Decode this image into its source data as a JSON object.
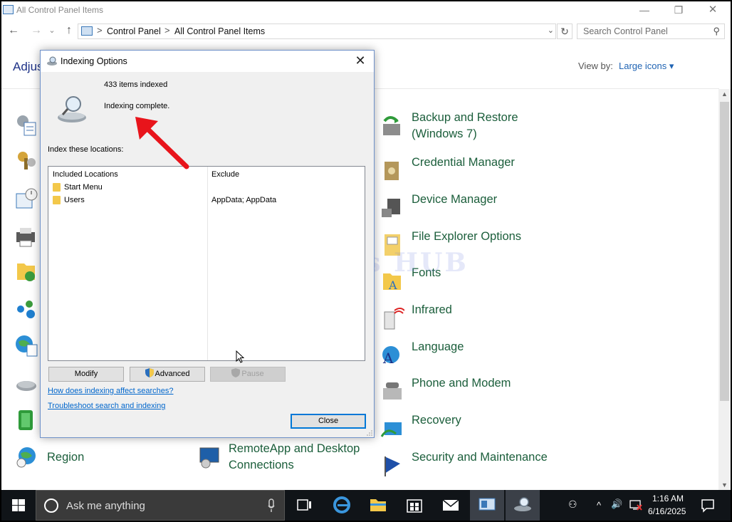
{
  "window": {
    "title": "All Control Panel Items",
    "minimize": "—",
    "restore": "❐",
    "close": "✕"
  },
  "nav": {
    "back": "←",
    "forward": "→",
    "dropdown": "⌄",
    "up": "↑"
  },
  "address": {
    "crumbs": [
      "Control Panel",
      "All Control Panel Items"
    ],
    "separator": ">",
    "dropdown": "⌄",
    "refresh": "↻"
  },
  "search": {
    "placeholder": "Search Control Panel",
    "icon": "⚲"
  },
  "header": {
    "title_partial": "Adjus",
    "view_by_label": "View by:",
    "view_by_value": "Large icons ▾"
  },
  "right_column_items": [
    {
      "label_line1": "Backup and Restore",
      "label_line2": "(Windows 7)",
      "icon": "backup-restore-icon"
    },
    {
      "label": "Credential Manager",
      "icon": "credential-manager-icon"
    },
    {
      "label": "Device Manager",
      "icon": "device-manager-icon"
    },
    {
      "label": "File Explorer Options",
      "icon": "file-explorer-options-icon"
    },
    {
      "label": "Fonts",
      "icon": "fonts-icon"
    },
    {
      "label": "Infrared",
      "icon": "infrared-icon"
    },
    {
      "label": "Language",
      "icon": "language-icon"
    },
    {
      "label": "Phone and Modem",
      "icon": "phone-modem-icon"
    },
    {
      "label": "Recovery",
      "icon": "recovery-icon"
    },
    {
      "label": "Security and Maintenance",
      "icon": "security-maintenance-icon"
    }
  ],
  "bottom_row": {
    "region": "Region",
    "remoteapp_line1": "RemoteApp and Desktop",
    "remoteapp_line2": "Connections"
  },
  "watermark": "IT Pros HUB",
  "dialog": {
    "title": "Indexing Options",
    "close_glyph": "✕",
    "items_indexed": "433 items indexed",
    "status": "Indexing complete.",
    "index_these": "Index these locations:",
    "columns": {
      "included": "Included Locations",
      "exclude": "Exclude"
    },
    "locations": [
      {
        "name": "Start Menu",
        "exclude": ""
      },
      {
        "name": "Users",
        "exclude": "AppData; AppData"
      }
    ],
    "buttons": {
      "modify": "Modify",
      "advanced": "Advanced",
      "pause": "Pause",
      "close": "Close"
    },
    "links": {
      "how_does": "How does indexing affect searches?",
      "troubleshoot": "Troubleshoot search and indexing"
    }
  },
  "taskbar": {
    "search_placeholder": "Ask me anything",
    "time": "1:16 AM",
    "date": "6/16/2025",
    "tray_up": "^",
    "volume": "🔊",
    "people": "⚇"
  },
  "colors": {
    "accent": "#0078d7",
    "link": "#0066cc",
    "cp_item_text": "#1b5e3b",
    "heading": "#1e3287",
    "annotation_arrow": "#e8141b"
  }
}
